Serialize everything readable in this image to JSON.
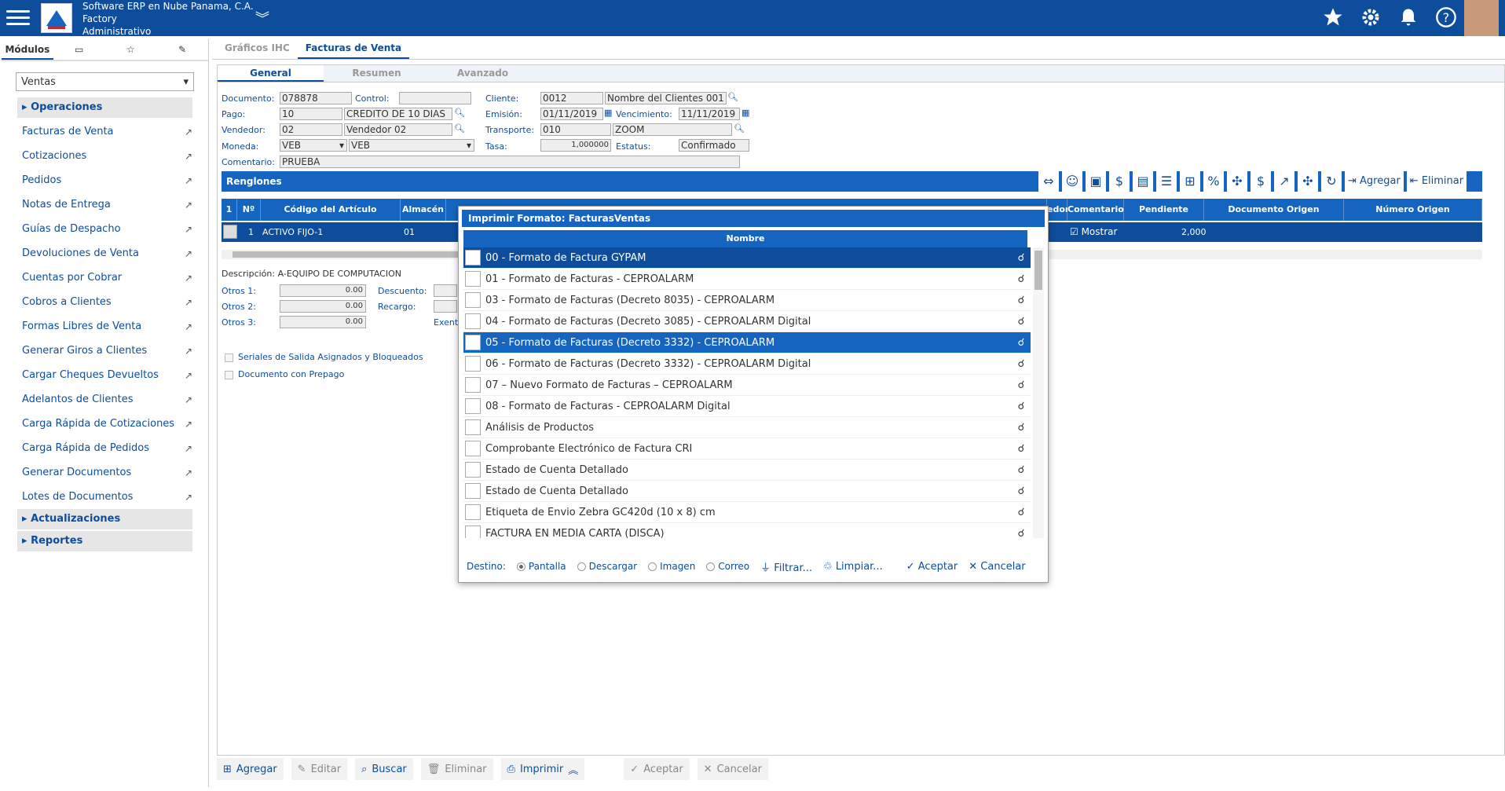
{
  "app": {
    "company": "Software ERP en Nube Panama, C.A.",
    "module": "Factory",
    "role": "Administrativo"
  },
  "sidebar": {
    "tabs": [
      "Módulos"
    ],
    "selected": "Ventas",
    "sections": {
      "operaciones": "Operaciones",
      "actualizaciones": "Actualizaciones",
      "reportes": "Reportes"
    },
    "items": [
      "Facturas de Venta",
      "Cotizaciones",
      "Pedidos",
      "Notas de Entrega",
      "Guías de Despacho",
      "Devoluciones de Venta",
      "Cuentas por Cobrar",
      "Cobros a Clientes",
      "Formas Libres de Venta",
      "Generar Giros a Clientes",
      "Cargar Cheques Devueltos",
      "Adelantos de Clientes",
      "Carga Rápida de Cotizaciones",
      "Carga Rápida de Pedidos",
      "Generar Documentos",
      "Lotes de Documentos"
    ]
  },
  "tabs": {
    "t1": "Gráficos IHC",
    "t2": "Facturas de Venta"
  },
  "subtabs": {
    "s1": "General",
    "s2": "Resumen",
    "s3": "Avanzado"
  },
  "form": {
    "documento_l": "Documento:",
    "documento": "078878",
    "control_l": "Control:",
    "control": "",
    "cliente_l": "Cliente:",
    "cliente": "0012",
    "cliente_n": "Nombre del Clientes 001",
    "pago_l": "Pago:",
    "pago": "10",
    "pago_n": "CREDITO DE 10 DIAS",
    "emision_l": "Emisión:",
    "emision": "01/11/2019",
    "venc_l": "Vencimiento:",
    "venc": "11/11/2019",
    "vendedor_l": "Vendedor:",
    "vendedor": "02",
    "vendedor_n": "Vendedor 02",
    "transp_l": "Transporte:",
    "transp": "010",
    "transp_n": "ZOOM",
    "moneda_l": "Moneda:",
    "moneda": "VEB",
    "moneda_n": "VEB",
    "tasa_l": "Tasa:",
    "tasa": "1,000000",
    "estatus_l": "Estatus:",
    "estatus": "Confirmado",
    "coment_l": "Comentario:",
    "coment": "PRUEBA"
  },
  "grid": {
    "title": "Renglones",
    "cols": {
      "c1": "1",
      "c2": "Nº",
      "c3": "Código del Artículo",
      "c4": "Almacén",
      "c5": "edor",
      "c6": "Comentario",
      "c7": "Pendiente",
      "c8": "Documento Origen",
      "c9": "Número Origen"
    },
    "row": {
      "n": "1",
      "codigo": "ACTIVO FIJO-1",
      "almacen": "01",
      "comentario": "Mostrar",
      "pendiente": "2,000"
    },
    "agregar": "Agregar",
    "eliminar": "Eliminar"
  },
  "details": {
    "descripcion": "Descripción: A-EQUIPO DE COMPUTACION",
    "otros1_l": "Otros 1:",
    "otros1": "0.00",
    "otros2_l": "Otros 2:",
    "otros2": "0.00",
    "otros3_l": "Otros 3:",
    "otros3": "0.00",
    "descuento_l": "Descuento:",
    "recargo_l": "Recargo:",
    "exent_l": "Exent",
    "seriales": "Seriales de Salida Asignados y Bloqueados",
    "prepago": "Documento con Prepago"
  },
  "bottom": {
    "agregar": "Agregar",
    "editar": "Editar",
    "buscar": "Buscar",
    "eliminar": "Eliminar",
    "imprimir": "Imprimir",
    "aceptar": "Aceptar",
    "cancelar": "Cancelar"
  },
  "dialog": {
    "title": "Imprimir Formato: FacturasVentas",
    "col": "Nombre",
    "rows": [
      "00 - Formato de Factura GYPAM",
      "01 - Formato de Facturas - CEPROALARM",
      "03 - Formato de Facturas (Decreto 8035) - CEPROALARM",
      "04 - Formato de Facturas (Decreto 3085) - CEPROALARM Digital",
      "05 - Formato de Facturas (Decreto 3332) - CEPROALARM",
      "06 - Formato de Facturas (Decreto 3332) - CEPROALARM Digital",
      "07 – Nuevo Formato de Facturas – CEPROALARM",
      "08 - Formato de Facturas - CEPROALARM Digital",
      "Análisis de Productos",
      "Comprobante Electrónico de Factura CRI",
      "Estado de Cuenta Detallado",
      "Estado de Cuenta Detallado",
      "Etiqueta de Envio Zebra GC420d (10 x 8) cm",
      "FACTURA EN MEDIA CARTA (DISCA)"
    ],
    "destino": "Destino:",
    "pantalla": "Pantalla",
    "descargar": "Descargar",
    "imagen": "Imagen",
    "correo": "Correo",
    "filtrar": "Filtrar...",
    "limpiar": "Limpiar...",
    "aceptar": "Aceptar",
    "cancelar": "Cancelar"
  }
}
